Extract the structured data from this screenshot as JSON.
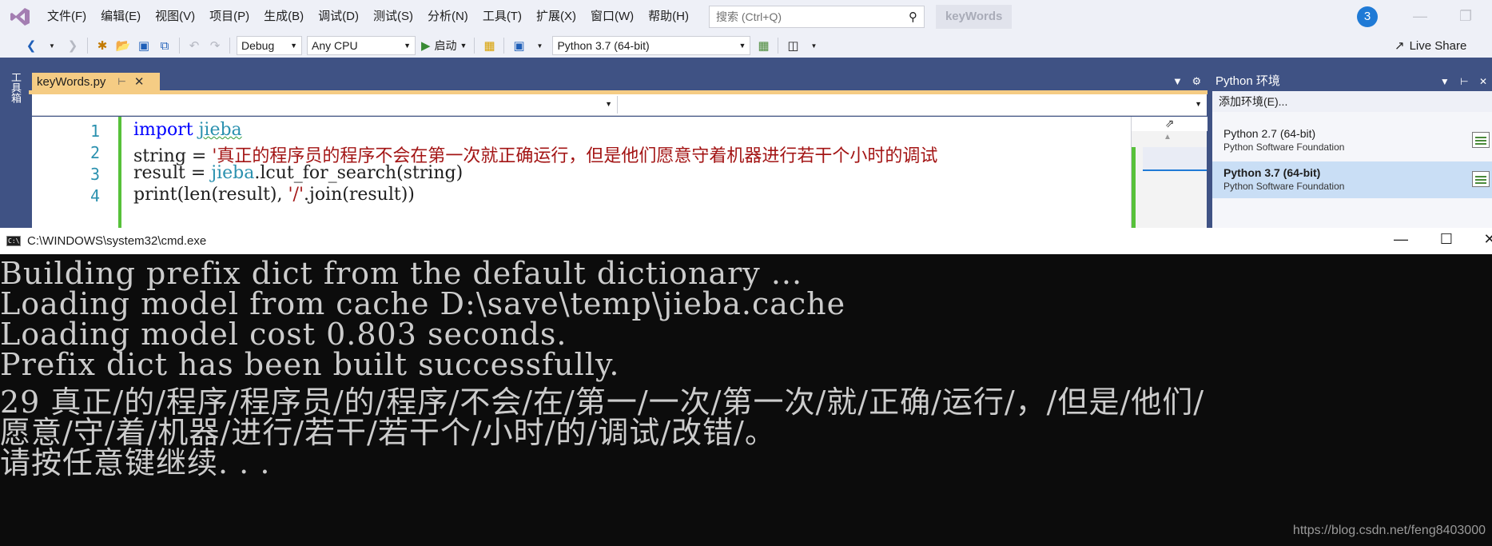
{
  "vs": {
    "menu": [
      "文件(F)",
      "编辑(E)",
      "视图(V)",
      "项目(P)",
      "生成(B)",
      "调试(D)",
      "测试(S)",
      "分析(N)",
      "工具(T)",
      "扩展(X)",
      "窗口(W)",
      "帮助(H)"
    ],
    "search_placeholder": "搜索 (Ctrl+Q)",
    "solution_title": "keyWords",
    "notification_count": "3",
    "toolbar": {
      "configuration": "Debug",
      "platform": "Any CPU",
      "start_label": "启动",
      "python_env": "Python 3.7 (64-bit)"
    },
    "live_share": "Live Share",
    "toolbox_label": "工具箱",
    "doc_tab": "keyWords.py",
    "editor": {
      "line_numbers": [
        "1",
        "2",
        "3",
        "4"
      ],
      "line1": {
        "kw": "import",
        "mod": "jieba"
      },
      "line2": {
        "lhs": "string = ",
        "str": "'真正的程序员的程序不会在第一次就正确运行，但是他们愿意守着机器进行若干个小时的调试"
      },
      "line3": {
        "lhs": "result = ",
        "mod": "jieba",
        "rest": ".lcut_for_search(string)"
      },
      "line4": {
        "pre": "print(len(result), ",
        "str": "'/'",
        "rest": ".join(result))"
      }
    },
    "py_env_panel": {
      "title": "Python 环境",
      "add_env": "添加环境(E)...",
      "envs": [
        {
          "name": "Python 2.7 (64-bit)",
          "vendor": "Python Software Foundation",
          "selected": false
        },
        {
          "name": "Python 3.7 (64-bit)",
          "vendor": "Python Software Foundation",
          "selected": true
        }
      ]
    }
  },
  "cmd": {
    "title": "C:\\WINDOWS\\system32\\cmd.exe",
    "lines": [
      "Building prefix dict from the default dictionary ...",
      "Loading model from cache D:\\save\\temp\\jieba.cache",
      "Loading model cost 0.803 seconds.",
      "Prefix dict has been built successfully.",
      "29 真正/的/程序/程序员/的/程序/不会/在/第一/一次/第一次/就/正确/运行/，/但是/他们/",
      "愿意/守/着/机器/进行/若干/若干个/小时/的/调试/改错/。",
      "请按任意键继续. . ."
    ],
    "watermark": "https://blog.csdn.net/feng8403000"
  }
}
